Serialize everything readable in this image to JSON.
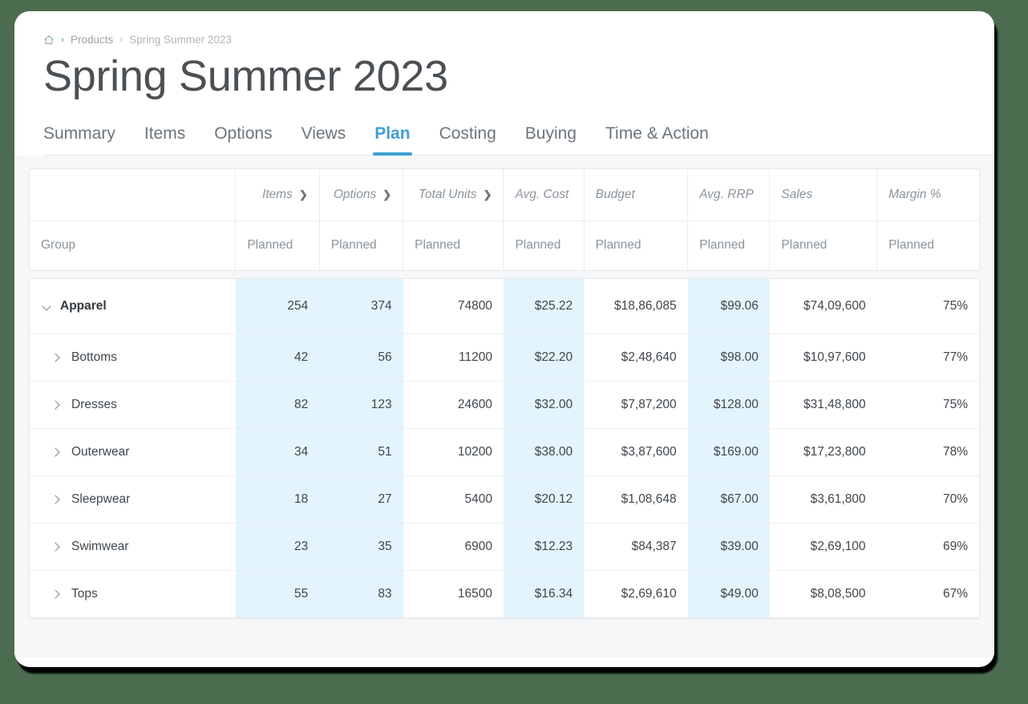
{
  "breadcrumb": {
    "home_icon": "home-icon",
    "separator": "›",
    "items": [
      {
        "label": "Products"
      },
      {
        "label": "Spring Summer 2023"
      }
    ]
  },
  "page_title": "Spring Summer 2023",
  "tabs": {
    "items": [
      {
        "label": "Summary",
        "active": false
      },
      {
        "label": "Items",
        "active": false
      },
      {
        "label": "Options",
        "active": false
      },
      {
        "label": "Views",
        "active": false
      },
      {
        "label": "Plan",
        "active": true
      },
      {
        "label": "Costing",
        "active": false
      },
      {
        "label": "Buying",
        "active": false
      },
      {
        "label": "Time & Action",
        "active": false
      }
    ],
    "active_label": "Plan",
    "accent_color": "#3f9fd4"
  },
  "table": {
    "group_header": "",
    "group_sub_header": "Group",
    "metric_headers": [
      {
        "label": "Items",
        "expandable": true
      },
      {
        "label": "Options",
        "expandable": true
      },
      {
        "label": "Total Units",
        "expandable": true
      },
      {
        "label": "Avg. Cost",
        "expandable": false
      },
      {
        "label": "Budget",
        "expandable": false
      },
      {
        "label": "Avg. RRP",
        "expandable": false
      },
      {
        "label": "Sales",
        "expandable": false
      },
      {
        "label": "Margin %",
        "expandable": false
      }
    ],
    "sub_headers": [
      "Planned",
      "Planned",
      "Planned",
      "Planned",
      "Planned",
      "Planned",
      "Planned",
      "Planned"
    ],
    "highlight_color": "#e4f4fc",
    "highlighted_columns": [
      "Items",
      "Options",
      "Avg. Cost",
      "Avg. RRP"
    ],
    "rows": [
      {
        "name": "Apparel",
        "level": 0,
        "expanded": true,
        "caret": "chevron-down-icon",
        "items": "254",
        "options": "374",
        "total_units": "74800",
        "avg_cost": "$25.22",
        "budget": "$18,86,085",
        "avg_rrp": "$99.06",
        "sales": "$74,09,600",
        "margin": "75%"
      },
      {
        "name": "Bottoms",
        "level": 1,
        "expanded": false,
        "caret": "chevron-right-icon",
        "items": "42",
        "options": "56",
        "total_units": "11200",
        "avg_cost": "$22.20",
        "budget": "$2,48,640",
        "avg_rrp": "$98.00",
        "sales": "$10,97,600",
        "margin": "77%"
      },
      {
        "name": "Dresses",
        "level": 1,
        "expanded": false,
        "caret": "chevron-right-icon",
        "items": "82",
        "options": "123",
        "total_units": "24600",
        "avg_cost": "$32.00",
        "budget": "$7,87,200",
        "avg_rrp": "$128.00",
        "sales": "$31,48,800",
        "margin": "75%"
      },
      {
        "name": "Outerwear",
        "level": 1,
        "expanded": false,
        "caret": "chevron-right-icon",
        "items": "34",
        "options": "51",
        "total_units": "10200",
        "avg_cost": "$38.00",
        "budget": "$3,87,600",
        "avg_rrp": "$169.00",
        "sales": "$17,23,800",
        "margin": "78%"
      },
      {
        "name": "Sleepwear",
        "level": 1,
        "expanded": false,
        "caret": "chevron-right-icon",
        "items": "18",
        "options": "27",
        "total_units": "5400",
        "avg_cost": "$20.12",
        "budget": "$1,08,648",
        "avg_rrp": "$67.00",
        "sales": "$3,61,800",
        "margin": "70%"
      },
      {
        "name": "Swimwear",
        "level": 1,
        "expanded": false,
        "caret": "chevron-right-icon",
        "items": "23",
        "options": "35",
        "total_units": "6900",
        "avg_cost": "$12.23",
        "budget": "$84,387",
        "avg_rrp": "$39.00",
        "sales": "$2,69,100",
        "margin": "69%"
      },
      {
        "name": "Tops",
        "level": 1,
        "expanded": false,
        "caret": "chevron-right-icon",
        "items": "55",
        "options": "83",
        "total_units": "16500",
        "avg_cost": "$16.34",
        "budget": "$2,69,610",
        "avg_rrp": "$49.00",
        "sales": "$8,08,500",
        "margin": "67%"
      }
    ]
  }
}
